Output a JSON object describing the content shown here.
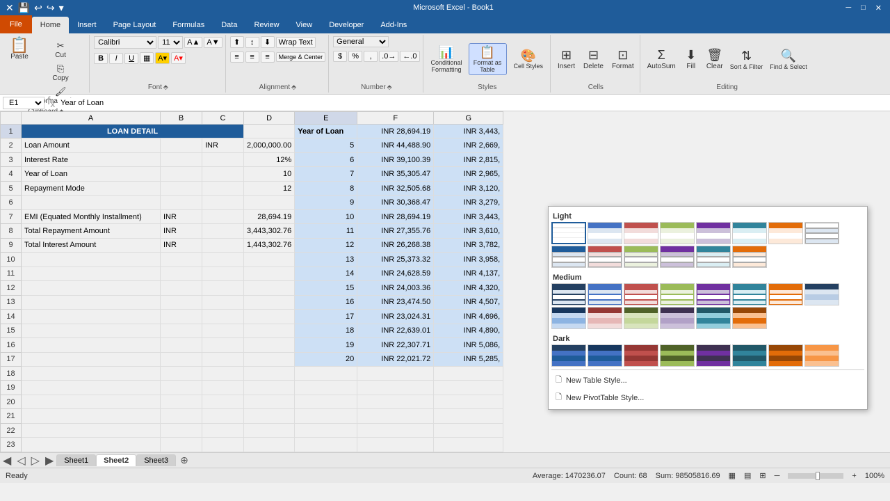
{
  "app": {
    "title": "Microsoft Excel - Book1",
    "windowControls": [
      "minimize",
      "restore",
      "close"
    ]
  },
  "tabs": {
    "file": "File",
    "items": [
      "Home",
      "Insert",
      "Page Layout",
      "Formulas",
      "Data",
      "Review",
      "View",
      "Developer",
      "Add-Ins"
    ],
    "active": "Home"
  },
  "quickAccess": {
    "buttons": [
      "save",
      "undo",
      "redo",
      "customize"
    ]
  },
  "ribbon": {
    "clipboard": {
      "label": "Clipboard",
      "paste": "Paste",
      "cut": "Cut",
      "copy": "Copy",
      "formatPainter": "Format Painter"
    },
    "font": {
      "label": "Font",
      "fontName": "Calibri",
      "fontSize": "11",
      "bold": "B",
      "italic": "I",
      "underline": "U"
    },
    "alignment": {
      "label": "Alignment",
      "wrapText": "Wrap Text",
      "mergeCenter": "Merge & Center"
    },
    "number": {
      "label": "Number",
      "format": "General"
    },
    "styles": {
      "label": "Styles",
      "conditionalFormatting": "Conditional Formatting",
      "formatAsTable": "Format as Table",
      "cellStyles": "Cell Styles"
    },
    "cells": {
      "label": "Cells",
      "insert": "Insert",
      "delete": "Delete",
      "format": "Format"
    },
    "editing": {
      "label": "Editing",
      "autoSum": "AutoSum",
      "fill": "Fill",
      "clear": "Clear",
      "sortFilter": "Sort & Filter",
      "findSelect": "Find & Select"
    }
  },
  "formulaBar": {
    "cellRef": "E1",
    "formula": "Year of Loan"
  },
  "grid": {
    "columns": [
      "",
      "A",
      "B",
      "C",
      "D",
      "E",
      "F",
      "G"
    ],
    "rows": [
      {
        "num": "1",
        "cells": [
          "LOAN DETAIL",
          "",
          "",
          "",
          "Year of Loan",
          "INR 28,694.19",
          "INR 3,443,"
        ]
      },
      {
        "num": "2",
        "cells": [
          "Loan Amount",
          "",
          "INR",
          "2,000,000.00",
          "5",
          "INR 44,488.90",
          "INR 2,669,"
        ]
      },
      {
        "num": "3",
        "cells": [
          "Interest Rate",
          "",
          "",
          "12%",
          "6",
          "INR 39,100.39",
          "INR 2,815,"
        ]
      },
      {
        "num": "4",
        "cells": [
          "Year of Loan",
          "",
          "",
          "10",
          "7",
          "INR 35,305.47",
          "INR 2,965,"
        ]
      },
      {
        "num": "5",
        "cells": [
          "Repayment Mode",
          "",
          "",
          "12",
          "8",
          "INR 32,505.68",
          "INR 3,120,"
        ]
      },
      {
        "num": "6",
        "cells": [
          "",
          "",
          "",
          "",
          "9",
          "INR 30,368.47",
          "INR 3,279,"
        ]
      },
      {
        "num": "7",
        "cells": [
          "EMI (Equated Monthly Installment)",
          "INR",
          "",
          "28,694.19",
          "10",
          "INR 28,694.19",
          "INR 3,443,"
        ]
      },
      {
        "num": "8",
        "cells": [
          "Total Repayment Amount",
          "INR",
          "",
          "3,443,302.76",
          "11",
          "INR 27,355.76",
          "INR 3,610,"
        ]
      },
      {
        "num": "9",
        "cells": [
          "Total Interest Amount",
          "INR",
          "",
          "1,443,302.76",
          "12",
          "INR 26,268.38",
          "INR 3,782,"
        ]
      },
      {
        "num": "10",
        "cells": [
          "",
          "",
          "",
          "",
          "13",
          "INR 25,373.32",
          "INR 3,958,"
        ]
      },
      {
        "num": "11",
        "cells": [
          "",
          "",
          "",
          "",
          "14",
          "INR 24,628.59",
          "INR 4,137,"
        ]
      },
      {
        "num": "12",
        "cells": [
          "",
          "",
          "",
          "",
          "15",
          "INR 24,003.36",
          "INR 4,320,"
        ]
      },
      {
        "num": "13",
        "cells": [
          "",
          "",
          "",
          "",
          "16",
          "INR 23,474.50",
          "INR 4,507,"
        ]
      },
      {
        "num": "14",
        "cells": [
          "",
          "",
          "",
          "",
          "17",
          "INR 23,024.31",
          "INR 4,696,"
        ]
      },
      {
        "num": "15",
        "cells": [
          "",
          "",
          "",
          "",
          "18",
          "INR 22,639.01",
          "INR 4,890,"
        ]
      },
      {
        "num": "16",
        "cells": [
          "",
          "",
          "",
          "",
          "19",
          "INR 22,307.71",
          "INR 5,086,"
        ]
      },
      {
        "num": "17",
        "cells": [
          "",
          "",
          "",
          "",
          "20",
          "INR 22,021.72",
          "INR 5,285,"
        ]
      }
    ]
  },
  "tableStyles": {
    "sections": {
      "light": {
        "label": "Light",
        "styles": [
          {
            "id": "l0",
            "colors": [
              [
                "#ffffff",
                "#ffffff",
                "#ffffff",
                "#ffffff"
              ],
              [
                "#dce6f1",
                "#dce6f1",
                "#dce6f1",
                "#dce6f1"
              ],
              [
                "#ffffff",
                "#ffffff",
                "#ffffff",
                "#ffffff"
              ],
              [
                "#dce6f1",
                "#dce6f1",
                "#dce6f1",
                "#dce6f1"
              ]
            ],
            "header": "#1f5c9a"
          },
          {
            "id": "l1",
            "colors": [
              [
                "#dce6f1",
                "#dce6f1",
                "#dce6f1",
                "#dce6f1"
              ],
              [
                "#ffffff",
                "#ffffff",
                "#ffffff",
                "#ffffff"
              ],
              [
                "#dce6f1",
                "#dce6f1",
                "#dce6f1",
                "#dce6f1"
              ],
              [
                "#ffffff",
                "#ffffff",
                "#ffffff",
                "#ffffff"
              ]
            ],
            "header": "#4472c4"
          },
          {
            "id": "l2",
            "colors": [
              [
                "#f2dcdb",
                "#f2dcdb",
                "#f2dcdb",
                "#f2dcdb"
              ],
              [
                "#ffffff",
                "#ffffff",
                "#ffffff",
                "#ffffff"
              ],
              [
                "#f2dcdb",
                "#f2dcdb",
                "#f2dcdb",
                "#f2dcdb"
              ],
              [
                "#ffffff",
                "#ffffff",
                "#ffffff",
                "#ffffff"
              ]
            ],
            "header": "#c0504d"
          },
          {
            "id": "l3",
            "colors": [
              [
                "#ebf1de",
                "#ebf1de",
                "#ebf1de",
                "#ebf1de"
              ],
              [
                "#ffffff",
                "#ffffff",
                "#ffffff",
                "#ffffff"
              ],
              [
                "#ebf1de",
                "#ebf1de",
                "#ebf1de",
                "#ebf1de"
              ],
              [
                "#ffffff",
                "#ffffff",
                "#ffffff",
                "#ffffff"
              ]
            ],
            "header": "#9bbb59"
          },
          {
            "id": "l4",
            "colors": [
              [
                "#e6b8a2",
                "#e6b8a2",
                "#e6b8a2",
                "#e6b8a2"
              ],
              [
                "#ffffff",
                "#ffffff",
                "#ffffff",
                "#ffffff"
              ],
              [
                "#e6b8a2",
                "#e6b8a2",
                "#e6b8a2",
                "#e6b8a2"
              ],
              [
                "#ffffff",
                "#ffffff",
                "#ffffff",
                "#ffffff"
              ]
            ],
            "header": "#e36c09"
          },
          {
            "id": "l5",
            "colors": [
              [
                "#ccc0da",
                "#ccc0da",
                "#ccc0da",
                "#ccc0da"
              ],
              [
                "#ffffff",
                "#ffffff",
                "#ffffff",
                "#ffffff"
              ],
              [
                "#ccc0da",
                "#ccc0da",
                "#ccc0da",
                "#ccc0da"
              ],
              [
                "#ffffff",
                "#ffffff",
                "#ffffff",
                "#ffffff"
              ]
            ],
            "header": "#7030a0"
          },
          {
            "id": "l6",
            "colors": [
              [
                "#daeef3",
                "#daeef3",
                "#daeef3",
                "#daeef3"
              ],
              [
                "#ffffff",
                "#ffffff",
                "#ffffff",
                "#ffffff"
              ],
              [
                "#daeef3",
                "#daeef3",
                "#daeef3",
                "#daeef3"
              ],
              [
                "#ffffff",
                "#ffffff",
                "#ffffff",
                "#ffffff"
              ]
            ],
            "header": "#31849b"
          },
          {
            "id": "l7",
            "colors": [
              [
                "#fde9d9",
                "#fde9d9",
                "#fde9d9",
                "#fde9d9"
              ],
              [
                "#ffffff",
                "#ffffff",
                "#ffffff",
                "#ffffff"
              ],
              [
                "#fde9d9",
                "#fde9d9",
                "#fde9d9",
                "#fde9d9"
              ],
              [
                "#ffffff",
                "#ffffff",
                "#ffffff",
                "#ffffff"
              ]
            ],
            "header": "#f79646"
          }
        ]
      },
      "medium": {
        "label": "Medium",
        "styles": [
          {
            "id": "m0",
            "header": "#1f5c9a",
            "alt": "#dce6f1"
          },
          {
            "id": "m1",
            "header": "#4472c4",
            "alt": "#dce6f1"
          },
          {
            "id": "m2",
            "header": "#c0504d",
            "alt": "#f2dcdb"
          },
          {
            "id": "m3",
            "header": "#9bbb59",
            "alt": "#ebf1de"
          },
          {
            "id": "m4",
            "header": "#e36c09",
            "alt": "#fde9d9"
          },
          {
            "id": "m5",
            "header": "#7030a0",
            "alt": "#ccc0da"
          },
          {
            "id": "m6",
            "header": "#31849b",
            "alt": "#daeef3"
          },
          {
            "id": "m7",
            "header": "#f79646",
            "alt": "#fde9d9"
          }
        ]
      },
      "dark": {
        "label": "Dark",
        "styles": [
          {
            "id": "d0",
            "header": "#244061"
          },
          {
            "id": "d1",
            "header": "#17375e"
          },
          {
            "id": "d2",
            "header": "#953734"
          },
          {
            "id": "d3",
            "header": "#4f6228"
          },
          {
            "id": "d4",
            "header": "#974706"
          },
          {
            "id": "d5",
            "header": "#3f3151"
          },
          {
            "id": "d6",
            "header": "#215868"
          },
          {
            "id": "d7",
            "header": "#974706"
          }
        ]
      }
    },
    "newTableStyle": "New Table Style...",
    "newPivotTableStyle": "New PivotTable Style..."
  },
  "statusBar": {
    "ready": "Ready",
    "average": "Average: 1470236.07",
    "count": "Count: 68",
    "sum": "Sum: 98505816.69",
    "zoom": "100%"
  },
  "sheets": [
    "Sheet1",
    "Sheet2",
    "Sheet3"
  ],
  "activeSheet": "Sheet2"
}
